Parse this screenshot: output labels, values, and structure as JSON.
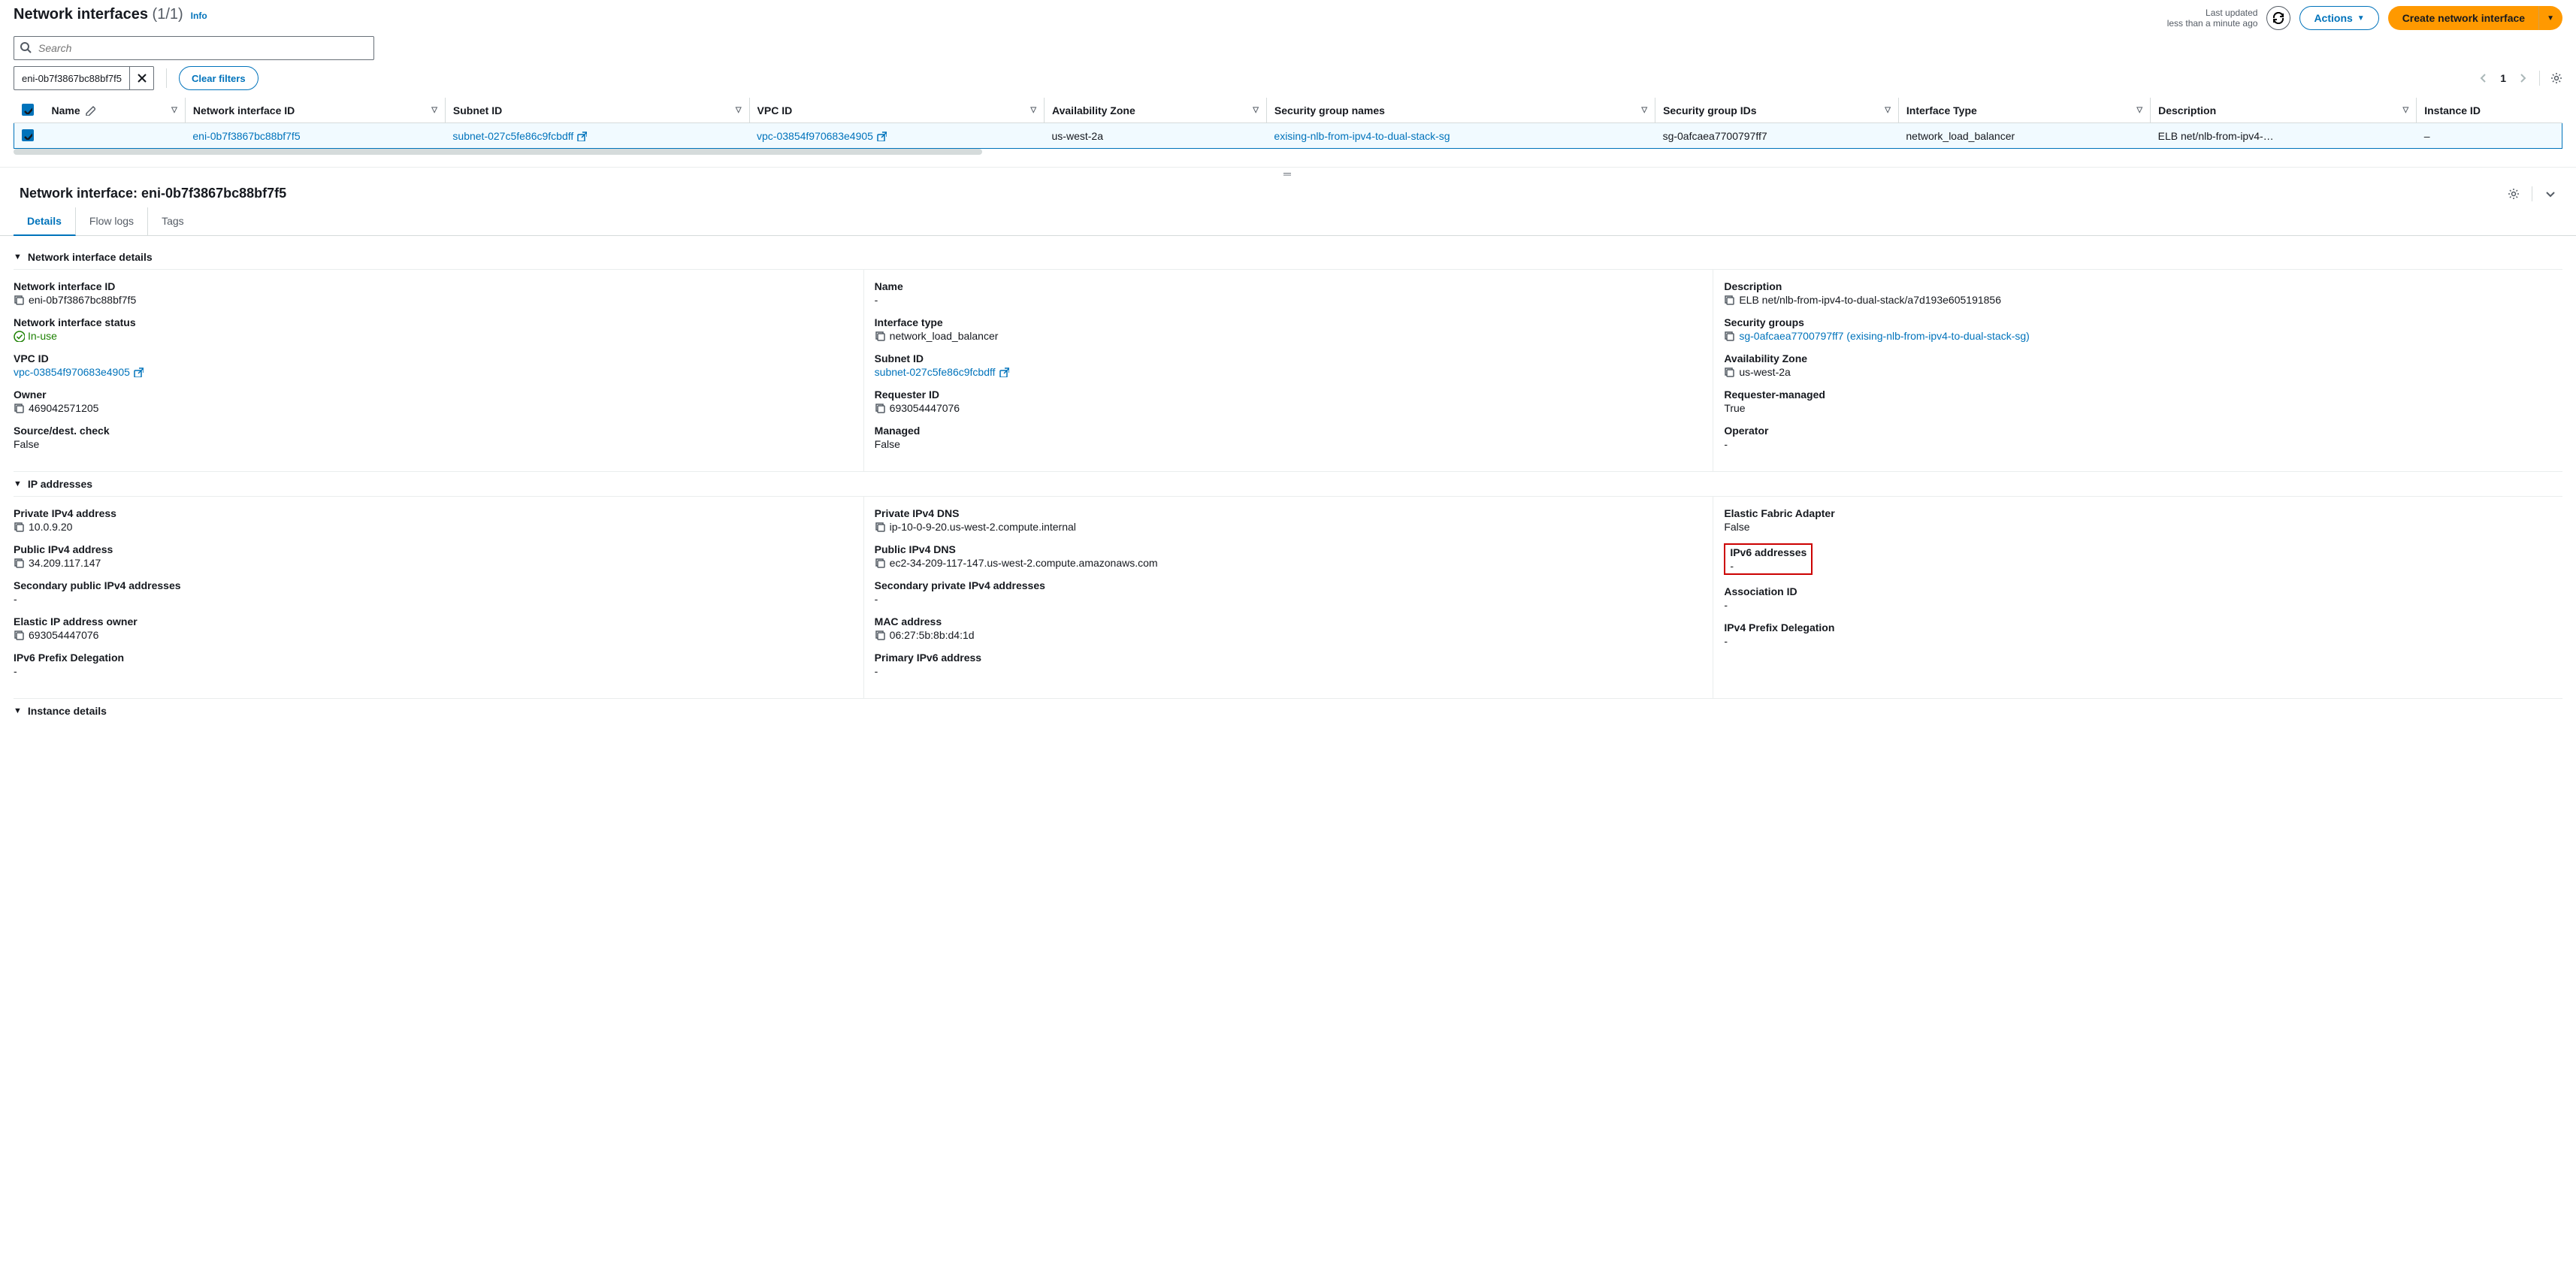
{
  "header": {
    "title": "Network interfaces",
    "count": "(1/1)",
    "info": "Info",
    "last_updated_1": "Last updated",
    "last_updated_2": "less than a minute ago",
    "actions": "Actions",
    "create": "Create network interface"
  },
  "search": {
    "placeholder": "Search"
  },
  "filters": {
    "token": "eni-0b7f3867bc88bf7f5",
    "clear": "Clear filters",
    "page": "1"
  },
  "columns": {
    "name": "Name",
    "eni": "Network interface ID",
    "subnet": "Subnet ID",
    "vpc": "VPC ID",
    "az": "Availability Zone",
    "sgn": "Security group names",
    "sgi": "Security group IDs",
    "itype": "Interface Type",
    "desc": "Description",
    "iid": "Instance ID"
  },
  "row": {
    "eni": "eni-0b7f3867bc88bf7f5",
    "subnet": "subnet-027c5fe86c9fcbdff",
    "vpc": "vpc-03854f970683e4905",
    "az": "us-west-2a",
    "sgn": "exising-nlb-from-ipv4-to-dual-stack-sg",
    "sgi": "sg-0afcaea7700797ff7",
    "itype": "network_load_balancer",
    "desc": "ELB net/nlb-from-ipv4-…",
    "iid": "–"
  },
  "detail": {
    "title": "Network interface: eni-0b7f3867bc88bf7f5"
  },
  "tabs": {
    "details": "Details",
    "flow": "Flow logs",
    "tags": "Tags"
  },
  "sections": {
    "nid": "Network interface details",
    "ip": "IP addresses",
    "inst": "Instance details"
  },
  "fields": {
    "nid_l": "Network interface ID",
    "nid_v": "eni-0b7f3867bc88bf7f5",
    "status_l": "Network interface status",
    "status_v": "In-use",
    "vpc_l": "VPC ID",
    "vpc_v": "vpc-03854f970683e4905",
    "owner_l": "Owner",
    "owner_v": "469042571205",
    "sdc_l": "Source/dest. check",
    "sdc_v": "False",
    "name_l": "Name",
    "dash": "-",
    "itype_l": "Interface type",
    "itype_v": "network_load_balancer",
    "subnet_l": "Subnet ID",
    "subnet_v": "subnet-027c5fe86c9fcbdff",
    "req_l": "Requester ID",
    "req_v": "693054447076",
    "man_l": "Managed",
    "man_v": "False",
    "desc_l": "Description",
    "desc_v": "ELB net/nlb-from-ipv4-to-dual-stack/a7d193e605191856",
    "sg_l": "Security groups",
    "sg_v": "sg-0afcaea7700797ff7 (exising-nlb-from-ipv4-to-dual-stack-sg)",
    "az_l": "Availability Zone",
    "az_v": "us-west-2a",
    "rm_l": "Requester-managed",
    "rm_v": "True",
    "op_l": "Operator",
    "priv4_l": "Private IPv4 address",
    "priv4_v": "10.0.9.20",
    "pub4_l": "Public IPv4 address",
    "pub4_v": "34.209.117.147",
    "secpub_l": "Secondary public IPv4 addresses",
    "eipo_l": "Elastic IP address owner",
    "eipo_v": "693054447076",
    "ipv6pd_l": "IPv6 Prefix Delegation",
    "pdns4_l": "Private IPv4 DNS",
    "pdns4_v": "ip-10-0-9-20.us-west-2.compute.internal",
    "pubdns_l": "Public IPv4 DNS",
    "pubdns_v": "ec2-34-209-117-147.us-west-2.compute.amazonaws.com",
    "secpriv_l": "Secondary private IPv4 addresses",
    "mac_l": "MAC address",
    "mac_v": "06:27:5b:8b:d4:1d",
    "pipv6_l": "Primary IPv6 address",
    "efa_l": "Elastic Fabric Adapter",
    "efa_v": "False",
    "ipv6_l": "IPv6 addresses",
    "assoc_l": "Association ID",
    "ipv4pd_l": "IPv4 Prefix Delegation"
  }
}
